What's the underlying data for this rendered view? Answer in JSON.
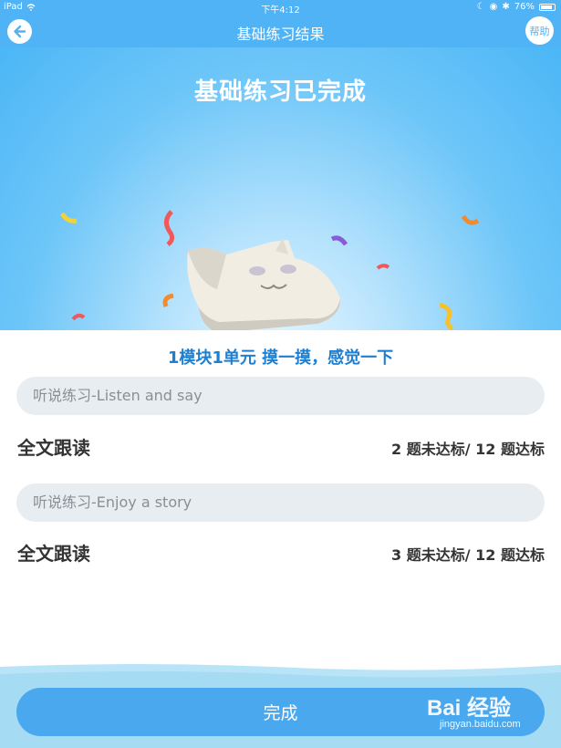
{
  "status_bar": {
    "device": "iPad",
    "time": "下午4:12",
    "battery": "76%"
  },
  "nav": {
    "title": "基础练习结果",
    "help_label": "帮助"
  },
  "hero": {
    "title": "基础练习已完成"
  },
  "unit_title": "1模块1单元 摸一摸，感觉一下",
  "sections": [
    {
      "header": "听说练习-Listen and say",
      "item_label": "全文跟读",
      "result": "2 题未达标/ 12 题达标"
    },
    {
      "header": "听说练习-Enjoy a story",
      "item_label": "全文跟读",
      "result": "3 题未达标/ 12 题达标"
    }
  ],
  "done_label": "完成",
  "watermark": {
    "brand": "Bai 经验",
    "url": "jingyan.baidu.com"
  },
  "colors": {
    "primary": "#4fb3f5",
    "button": "#4aa8ef",
    "unit_title": "#1e7fd0",
    "pill": "#e8edf1"
  },
  "icons": {
    "back": "arrow-left-icon",
    "wifi": "wifi-icon",
    "battery": "battery-icon",
    "mascot": "cat-mascot"
  }
}
